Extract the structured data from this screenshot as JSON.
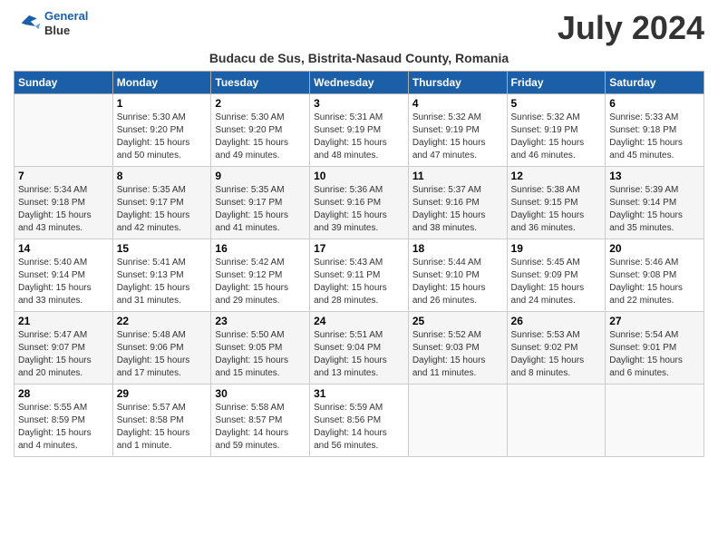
{
  "logo": {
    "line1": "General",
    "line2": "Blue"
  },
  "month_title": "July 2024",
  "subtitle": "Budacu de Sus, Bistrita-Nasaud County, Romania",
  "days_of_week": [
    "Sunday",
    "Monday",
    "Tuesday",
    "Wednesday",
    "Thursday",
    "Friday",
    "Saturday"
  ],
  "weeks": [
    [
      {
        "day": "",
        "sunrise": "",
        "sunset": "",
        "daylight": ""
      },
      {
        "day": "1",
        "sunrise": "Sunrise: 5:30 AM",
        "sunset": "Sunset: 9:20 PM",
        "daylight": "Daylight: 15 hours and 50 minutes."
      },
      {
        "day": "2",
        "sunrise": "Sunrise: 5:30 AM",
        "sunset": "Sunset: 9:20 PM",
        "daylight": "Daylight: 15 hours and 49 minutes."
      },
      {
        "day": "3",
        "sunrise": "Sunrise: 5:31 AM",
        "sunset": "Sunset: 9:19 PM",
        "daylight": "Daylight: 15 hours and 48 minutes."
      },
      {
        "day": "4",
        "sunrise": "Sunrise: 5:32 AM",
        "sunset": "Sunset: 9:19 PM",
        "daylight": "Daylight: 15 hours and 47 minutes."
      },
      {
        "day": "5",
        "sunrise": "Sunrise: 5:32 AM",
        "sunset": "Sunset: 9:19 PM",
        "daylight": "Daylight: 15 hours and 46 minutes."
      },
      {
        "day": "6",
        "sunrise": "Sunrise: 5:33 AM",
        "sunset": "Sunset: 9:18 PM",
        "daylight": "Daylight: 15 hours and 45 minutes."
      }
    ],
    [
      {
        "day": "7",
        "sunrise": "Sunrise: 5:34 AM",
        "sunset": "Sunset: 9:18 PM",
        "daylight": "Daylight: 15 hours and 43 minutes."
      },
      {
        "day": "8",
        "sunrise": "Sunrise: 5:35 AM",
        "sunset": "Sunset: 9:17 PM",
        "daylight": "Daylight: 15 hours and 42 minutes."
      },
      {
        "day": "9",
        "sunrise": "Sunrise: 5:35 AM",
        "sunset": "Sunset: 9:17 PM",
        "daylight": "Daylight: 15 hours and 41 minutes."
      },
      {
        "day": "10",
        "sunrise": "Sunrise: 5:36 AM",
        "sunset": "Sunset: 9:16 PM",
        "daylight": "Daylight: 15 hours and 39 minutes."
      },
      {
        "day": "11",
        "sunrise": "Sunrise: 5:37 AM",
        "sunset": "Sunset: 9:16 PM",
        "daylight": "Daylight: 15 hours and 38 minutes."
      },
      {
        "day": "12",
        "sunrise": "Sunrise: 5:38 AM",
        "sunset": "Sunset: 9:15 PM",
        "daylight": "Daylight: 15 hours and 36 minutes."
      },
      {
        "day": "13",
        "sunrise": "Sunrise: 5:39 AM",
        "sunset": "Sunset: 9:14 PM",
        "daylight": "Daylight: 15 hours and 35 minutes."
      }
    ],
    [
      {
        "day": "14",
        "sunrise": "Sunrise: 5:40 AM",
        "sunset": "Sunset: 9:14 PM",
        "daylight": "Daylight: 15 hours and 33 minutes."
      },
      {
        "day": "15",
        "sunrise": "Sunrise: 5:41 AM",
        "sunset": "Sunset: 9:13 PM",
        "daylight": "Daylight: 15 hours and 31 minutes."
      },
      {
        "day": "16",
        "sunrise": "Sunrise: 5:42 AM",
        "sunset": "Sunset: 9:12 PM",
        "daylight": "Daylight: 15 hours and 29 minutes."
      },
      {
        "day": "17",
        "sunrise": "Sunrise: 5:43 AM",
        "sunset": "Sunset: 9:11 PM",
        "daylight": "Daylight: 15 hours and 28 minutes."
      },
      {
        "day": "18",
        "sunrise": "Sunrise: 5:44 AM",
        "sunset": "Sunset: 9:10 PM",
        "daylight": "Daylight: 15 hours and 26 minutes."
      },
      {
        "day": "19",
        "sunrise": "Sunrise: 5:45 AM",
        "sunset": "Sunset: 9:09 PM",
        "daylight": "Daylight: 15 hours and 24 minutes."
      },
      {
        "day": "20",
        "sunrise": "Sunrise: 5:46 AM",
        "sunset": "Sunset: 9:08 PM",
        "daylight": "Daylight: 15 hours and 22 minutes."
      }
    ],
    [
      {
        "day": "21",
        "sunrise": "Sunrise: 5:47 AM",
        "sunset": "Sunset: 9:07 PM",
        "daylight": "Daylight: 15 hours and 20 minutes."
      },
      {
        "day": "22",
        "sunrise": "Sunrise: 5:48 AM",
        "sunset": "Sunset: 9:06 PM",
        "daylight": "Daylight: 15 hours and 17 minutes."
      },
      {
        "day": "23",
        "sunrise": "Sunrise: 5:50 AM",
        "sunset": "Sunset: 9:05 PM",
        "daylight": "Daylight: 15 hours and 15 minutes."
      },
      {
        "day": "24",
        "sunrise": "Sunrise: 5:51 AM",
        "sunset": "Sunset: 9:04 PM",
        "daylight": "Daylight: 15 hours and 13 minutes."
      },
      {
        "day": "25",
        "sunrise": "Sunrise: 5:52 AM",
        "sunset": "Sunset: 9:03 PM",
        "daylight": "Daylight: 15 hours and 11 minutes."
      },
      {
        "day": "26",
        "sunrise": "Sunrise: 5:53 AM",
        "sunset": "Sunset: 9:02 PM",
        "daylight": "Daylight: 15 hours and 8 minutes."
      },
      {
        "day": "27",
        "sunrise": "Sunrise: 5:54 AM",
        "sunset": "Sunset: 9:01 PM",
        "daylight": "Daylight: 15 hours and 6 minutes."
      }
    ],
    [
      {
        "day": "28",
        "sunrise": "Sunrise: 5:55 AM",
        "sunset": "Sunset: 8:59 PM",
        "daylight": "Daylight: 15 hours and 4 minutes."
      },
      {
        "day": "29",
        "sunrise": "Sunrise: 5:57 AM",
        "sunset": "Sunset: 8:58 PM",
        "daylight": "Daylight: 15 hours and 1 minute."
      },
      {
        "day": "30",
        "sunrise": "Sunrise: 5:58 AM",
        "sunset": "Sunset: 8:57 PM",
        "daylight": "Daylight: 14 hours and 59 minutes."
      },
      {
        "day": "31",
        "sunrise": "Sunrise: 5:59 AM",
        "sunset": "Sunset: 8:56 PM",
        "daylight": "Daylight: 14 hours and 56 minutes."
      },
      {
        "day": "",
        "sunrise": "",
        "sunset": "",
        "daylight": ""
      },
      {
        "day": "",
        "sunrise": "",
        "sunset": "",
        "daylight": ""
      },
      {
        "day": "",
        "sunrise": "",
        "sunset": "",
        "daylight": ""
      }
    ]
  ]
}
